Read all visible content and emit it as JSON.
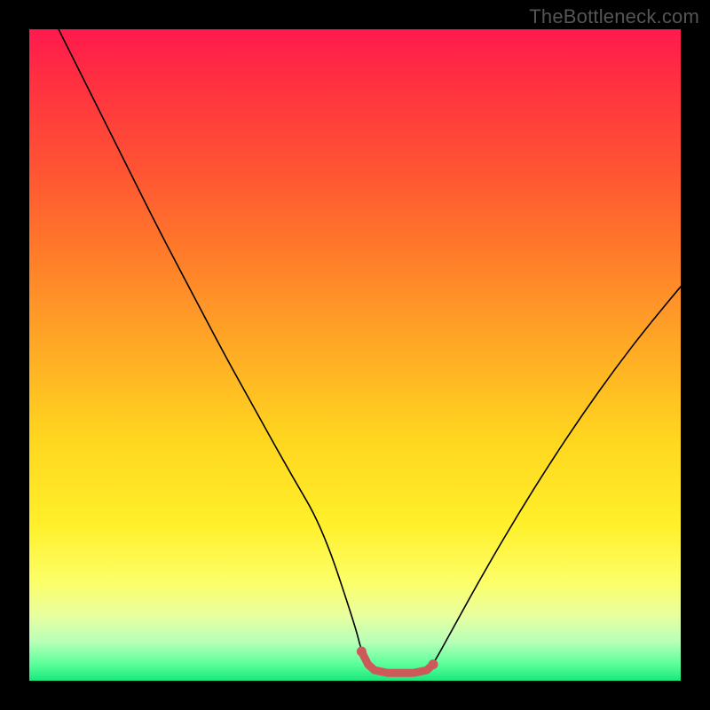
{
  "watermark": "TheBottleneck.com",
  "colors": {
    "background": "#000000",
    "curve": "#000000",
    "highlight": "#cc5a5a",
    "gradient_top": "#ff1a4d",
    "gradient_bottom": "#18e87a"
  },
  "chart_data": {
    "type": "line",
    "title": "",
    "xlabel": "",
    "ylabel": "",
    "xlim": [
      0,
      100
    ],
    "ylim": [
      0,
      100
    ],
    "x": [
      4.5,
      10,
      15,
      20,
      25,
      30,
      35,
      40,
      45,
      50,
      51,
      52,
      53,
      55,
      57,
      59,
      61,
      62,
      65,
      70,
      75,
      80,
      85,
      90,
      95,
      100
    ],
    "values": [
      100,
      89,
      79,
      69,
      59.5,
      50,
      41,
      32,
      23.5,
      8.5,
      4.5,
      2.5,
      1.6,
      1.2,
      1.2,
      1.2,
      1.6,
      2.5,
      8,
      17,
      25.5,
      33.5,
      41,
      48,
      54.5,
      60.5
    ],
    "highlight_segment": {
      "x": [
        51,
        52,
        53,
        55,
        57,
        59,
        61,
        62
      ],
      "y": [
        4.5,
        2.5,
        1.6,
        1.2,
        1.2,
        1.2,
        1.6,
        2.5
      ]
    }
  }
}
